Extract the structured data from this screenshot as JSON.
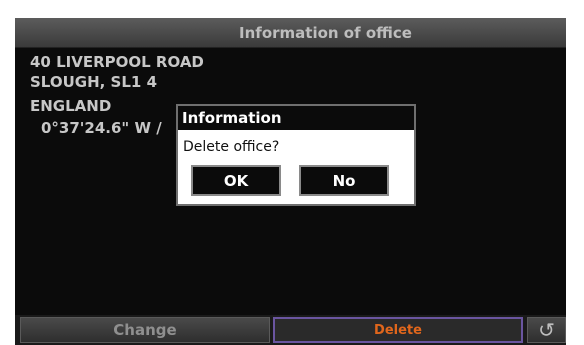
{
  "screen": {
    "title": "Information of office",
    "address": [
      "40 LIVERPOOL ROAD",
      "SLOUGH, SL1 4",
      "ENGLAND"
    ],
    "coordinates": "0°37'24.6\" W /"
  },
  "bottom_bar": {
    "change_label": "Change",
    "delete_label": "Delete",
    "back_icon": "back-arrow-icon"
  },
  "dialog": {
    "title": "Information",
    "message": "Delete office?",
    "ok_label": "OK",
    "no_label": "No"
  },
  "colors": {
    "screen_bg": "#0b0b0b",
    "title_text": "#bdbdbd",
    "delete_text": "#e0661c",
    "delete_border": "#6a55a0"
  }
}
